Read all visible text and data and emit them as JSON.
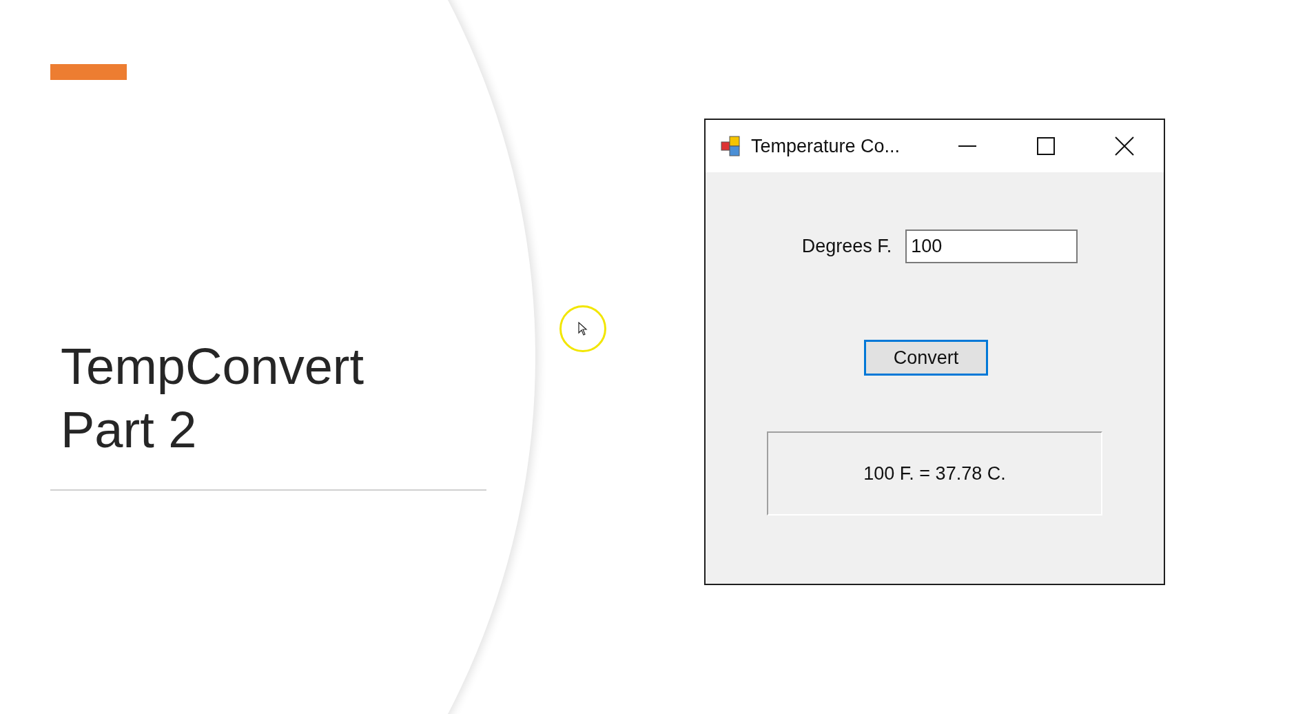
{
  "slide": {
    "title": "TempConvert\nPart 2"
  },
  "window": {
    "title": "Temperature Co...",
    "field_label": "Degrees F.",
    "field_value": "100",
    "button": {
      "label": "Convert",
      "focused": true
    },
    "result": "100 F. = 37.78 C."
  }
}
